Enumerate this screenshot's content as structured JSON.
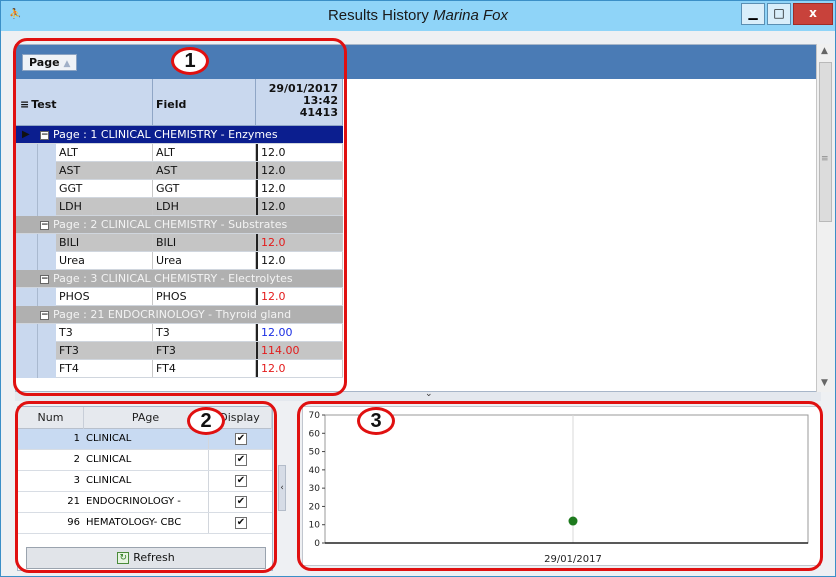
{
  "window": {
    "title_prefix": "Results History",
    "patient_name": "Marina Fox",
    "app_icon_glyph": "⛹",
    "min_glyph": "▁",
    "max_glyph": "□",
    "close_glyph": "x"
  },
  "grid": {
    "group_chip_label": "Page",
    "group_chip_sort_glyph": "▲",
    "menu_glyph": "≡",
    "col_test": "Test",
    "col_field": "Field",
    "col_date_line1": "29/01/2017",
    "col_date_line2": "13:42",
    "col_date_line3": "41413",
    "rows": [
      {
        "type": "group",
        "selected": true,
        "label": "Page :   1 CLINICAL CHEMISTRY - Enzymes"
      },
      {
        "type": "data",
        "alt": false,
        "test": "ALT",
        "field": "ALT",
        "value": "12.0",
        "color": "normal"
      },
      {
        "type": "data",
        "alt": true,
        "test": "AST",
        "field": "AST",
        "value": "12.0",
        "color": "normal"
      },
      {
        "type": "data",
        "alt": false,
        "test": "GGT",
        "field": "GGT",
        "value": "12.0",
        "color": "normal"
      },
      {
        "type": "data",
        "alt": true,
        "test": "LDH",
        "field": "LDH",
        "value": "12.0",
        "color": "normal"
      },
      {
        "type": "group",
        "selected": false,
        "label": "Page :   2 CLINICAL CHEMISTRY - Substrates"
      },
      {
        "type": "data",
        "alt": true,
        "test": "BILI",
        "field": "BILI",
        "value": "12.0",
        "color": "red"
      },
      {
        "type": "data",
        "alt": false,
        "test": "Urea",
        "field": "Urea",
        "value": "12.0",
        "color": "normal"
      },
      {
        "type": "group",
        "selected": false,
        "label": "Page :   3 CLINICAL CHEMISTRY - Electrolytes"
      },
      {
        "type": "data",
        "alt": false,
        "test": "PHOS",
        "field": "PHOS",
        "value": "12.0",
        "color": "red"
      },
      {
        "type": "group",
        "selected": false,
        "label": "Page :  21 ENDOCRINOLOGY - Thyroid gland"
      },
      {
        "type": "data",
        "alt": false,
        "test": "T3",
        "field": "T3",
        "value": "12.00",
        "color": "blue"
      },
      {
        "type": "data",
        "alt": true,
        "test": "FT3",
        "field": "FT3",
        "value": "114.00",
        "color": "red"
      },
      {
        "type": "data",
        "alt": false,
        "test": "FT4",
        "field": "FT4",
        "value": "12.0",
        "color": "red"
      }
    ],
    "colors": {
      "red": "#e31b1b",
      "blue": "#1b2ee3"
    }
  },
  "page_list": {
    "col_num": "Num",
    "col_page": "PAge",
    "col_display": "Display",
    "rows": [
      {
        "num": "1",
        "page": "CLINICAL",
        "checked": true,
        "selected": true
      },
      {
        "num": "2",
        "page": "CLINICAL",
        "checked": true,
        "selected": false
      },
      {
        "num": "3",
        "page": "CLINICAL",
        "checked": true,
        "selected": false
      },
      {
        "num": "21",
        "page": "ENDOCRINOLOGY -",
        "checked": true,
        "selected": false
      },
      {
        "num": "96",
        "page": "HEMATOLOGY- CBC",
        "checked": true,
        "selected": false
      }
    ],
    "check_glyph": "✔",
    "refresh_label": "Refresh",
    "refresh_icon_glyph": "↻"
  },
  "callouts": {
    "badge_1": "1",
    "badge_2": "2",
    "badge_3": "3"
  },
  "chart_data": {
    "type": "scatter",
    "x": [
      "29/01/2017"
    ],
    "y": [
      12
    ],
    "ylim": [
      0,
      70
    ],
    "yticks": [
      0,
      10,
      20,
      30,
      40,
      50,
      60,
      70
    ],
    "xticks": [
      "29/01/2017"
    ],
    "grid": true,
    "point_color": "#1e7a1e"
  },
  "misc": {
    "collapse_glyph": "‹",
    "split_grip_glyph": "⌄"
  }
}
